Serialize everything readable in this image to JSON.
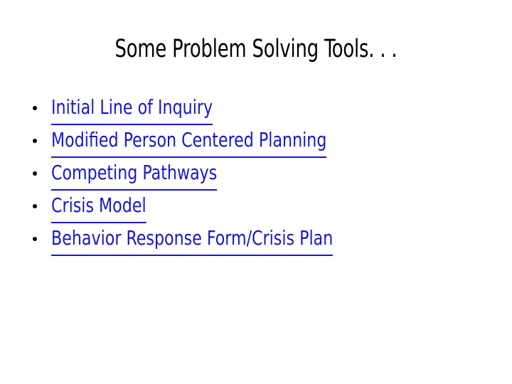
{
  "slide": {
    "background_color": "#ffffff",
    "title": "Some Problem Solving Tools. . .",
    "title_color": "#000000",
    "link_color": "#1a17c4",
    "bullet_color": "#000000",
    "bullet_glyph": "bullet-dot",
    "items": [
      {
        "label": "Initial Line of Inquiry"
      },
      {
        "label": "Modified Person Centered Planning"
      },
      {
        "label": "Competing Pathways"
      },
      {
        "label": "Crisis Model"
      },
      {
        "label": "Behavior Response Form/Crisis Plan"
      }
    ]
  }
}
